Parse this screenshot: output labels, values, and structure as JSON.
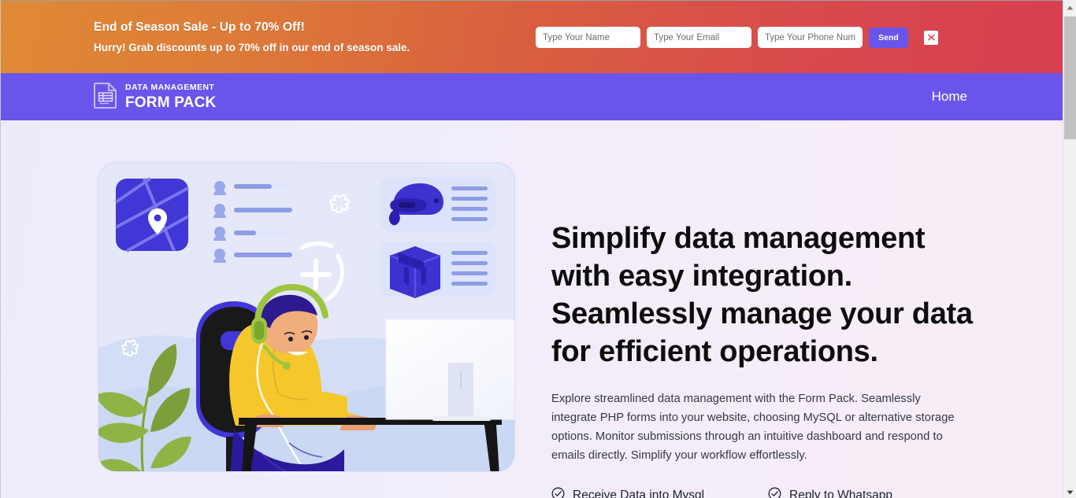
{
  "promo": {
    "title": "End of Season Sale - Up to 70% Off!",
    "subtitle": "Hurry! Grab discounts up to 70% off in our end of season sale.",
    "name_placeholder": "Type Your Name",
    "email_placeholder": "Type Your Email",
    "phone_placeholder": "Type Your Phone Number",
    "name_value": "",
    "email_value": "",
    "phone_value": "",
    "send_label": "Send",
    "close_icon": "close-x-icon",
    "gradient_start": "#e08a35",
    "gradient_end": "#d83f50",
    "send_color": "#6a55eb",
    "close_color": "#d8404f"
  },
  "navbar": {
    "brand_icon": "document-table-icon",
    "brand_top": "DATA MANAGEMENT",
    "brand_bottom": "FORM PACK",
    "background": "#6a55eb",
    "links": [
      {
        "label": "Home",
        "name": "nav-link-home"
      }
    ]
  },
  "hero": {
    "title": "Simplify data management with easy integration. Seamlessly manage your data for efficient operations.",
    "description": "Explore streamlined data management with the Form Pack. Seamlessly integrate PHP forms into your website, choosing MySQL or alternative storage options. Monitor submissions through an intuitive dashboard and respond to emails directly. Simplify your workflow effortlessly.",
    "features": [
      {
        "label": "Receive Data into Mysql",
        "icon": "check-circle-icon"
      },
      {
        "label": "Reply to Whatsapp",
        "icon": "check-circle-icon"
      }
    ],
    "illustration_name": "support-agent-at-desk-illustration",
    "background_start": "#edebfa",
    "background_end": "#f8edf6"
  },
  "scrollbar": {
    "up_icon": "scroll-up-arrow-icon",
    "down_icon": "scroll-down-arrow-icon",
    "thumb_name": "scrollbar-thumb"
  }
}
